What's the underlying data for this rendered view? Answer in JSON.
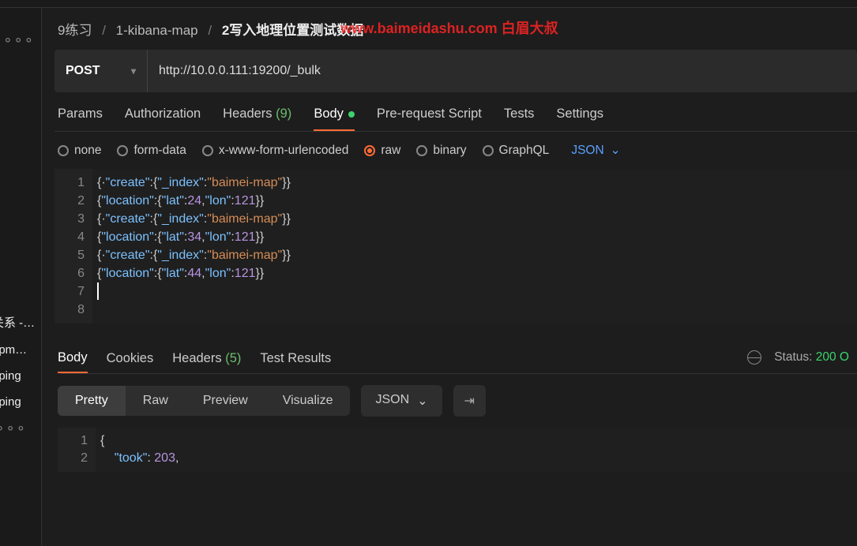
{
  "watermark": "www.baimeidashu.com 白眉大叔",
  "breadcrumb": {
    "items": [
      "9练习",
      "1-kibana-map",
      "2写入地理位置测试数据"
    ]
  },
  "request": {
    "method": "POST",
    "url": "http://10.0.0.111:19200/_bulk"
  },
  "reqTabs": {
    "params": "Params",
    "auth": "Authorization",
    "headers": "Headers",
    "headerCount": "(9)",
    "body": "Body",
    "prescript": "Pre-request Script",
    "tests": "Tests",
    "settings": "Settings"
  },
  "bodyTypes": {
    "none": "none",
    "form": "form-data",
    "urlenc": "x-www-form-urlencoded",
    "raw": "raw",
    "binary": "binary",
    "graphql": "GraphQL",
    "format": "JSON"
  },
  "code": {
    "lines": [
      "1",
      "2",
      "3",
      "4",
      "5",
      "6",
      "7",
      "8"
    ],
    "rows": [
      [
        [
          "p",
          "{"
        ],
        [
          "p",
          "·"
        ],
        [
          "k",
          "\"create\""
        ],
        [
          "p",
          ":{"
        ],
        [
          "k",
          "\"_index\""
        ],
        [
          "p",
          ":"
        ],
        [
          "s",
          "\"baimei-map\""
        ],
        [
          "p",
          "}}"
        ]
      ],
      [
        [
          "p",
          "{"
        ],
        [
          "k",
          "\"location\""
        ],
        [
          "p",
          ":{"
        ],
        [
          "k",
          "\"lat\""
        ],
        [
          "p",
          ":"
        ],
        [
          "n",
          "24"
        ],
        [
          "p",
          ","
        ],
        [
          "k",
          "\"lon\""
        ],
        [
          "p",
          ":"
        ],
        [
          "n",
          "121"
        ],
        [
          "p",
          "}}"
        ]
      ],
      [
        [
          "p",
          "{"
        ],
        [
          "p",
          "·"
        ],
        [
          "k",
          "\"create\""
        ],
        [
          "p",
          ":{"
        ],
        [
          "k",
          "\"_index\""
        ],
        [
          "p",
          ":"
        ],
        [
          "s",
          "\"baimei-map\""
        ],
        [
          "p",
          "}}"
        ]
      ],
      [
        [
          "p",
          "{"
        ],
        [
          "k",
          "\"location\""
        ],
        [
          "p",
          ":{"
        ],
        [
          "k",
          "\"lat\""
        ],
        [
          "p",
          ":"
        ],
        [
          "n",
          "34"
        ],
        [
          "p",
          ","
        ],
        [
          "k",
          "\"lon\""
        ],
        [
          "p",
          ":"
        ],
        [
          "n",
          "121"
        ],
        [
          "p",
          "}}"
        ]
      ],
      [
        [
          "p",
          "{"
        ],
        [
          "p",
          "·"
        ],
        [
          "k",
          "\"create\""
        ],
        [
          "p",
          ":{"
        ],
        [
          "k",
          "\"_index\""
        ],
        [
          "p",
          ":"
        ],
        [
          "s",
          "\"baimei-map\""
        ],
        [
          "p",
          "}}"
        ]
      ],
      [
        [
          "p",
          "{"
        ],
        [
          "k",
          "\"location\""
        ],
        [
          "p",
          ":{"
        ],
        [
          "k",
          "\"lat\""
        ],
        [
          "p",
          ":"
        ],
        [
          "n",
          "44"
        ],
        [
          "p",
          ","
        ],
        [
          "k",
          "\"lon\""
        ],
        [
          "p",
          ":"
        ],
        [
          "n",
          "121"
        ],
        [
          "p",
          "}}"
        ]
      ],
      [
        [
          "p",
          ""
        ]
      ],
      [
        [
          "p",
          ""
        ]
      ]
    ]
  },
  "sidebarItems": [
    "关系 -…",
    "-ipm…",
    "pping",
    "pping"
  ],
  "respTabs": {
    "body": "Body",
    "cookies": "Cookies",
    "headers": "Headers",
    "hcount": "(5)",
    "tests": "Test Results"
  },
  "respStatus": {
    "label": "Status:",
    "code": "200 O"
  },
  "viewModes": {
    "pretty": "Pretty",
    "raw": "Raw",
    "preview": "Preview",
    "viz": "Visualize",
    "fmt": "JSON"
  },
  "respCode": {
    "lines": [
      "1",
      "2"
    ],
    "rows": [
      [
        [
          "p",
          "{"
        ]
      ],
      [
        [
          "p",
          "    "
        ],
        [
          "k",
          "\"took\""
        ],
        [
          "p",
          ": "
        ],
        [
          "n",
          "203"
        ],
        [
          "p",
          ","
        ]
      ]
    ]
  }
}
